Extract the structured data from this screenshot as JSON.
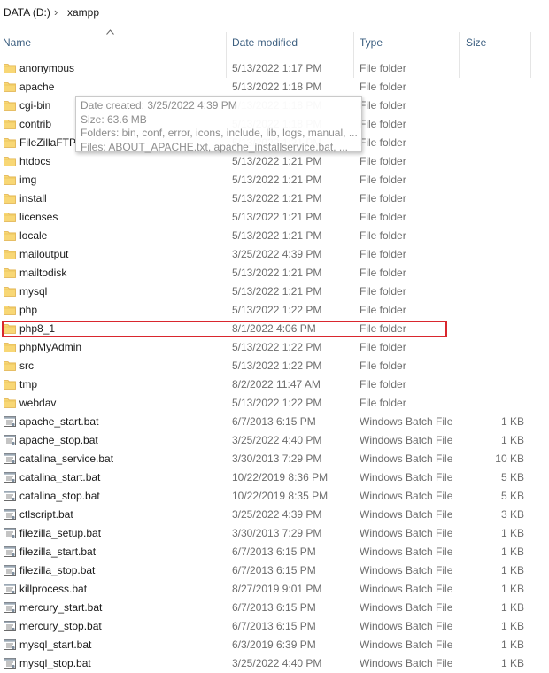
{
  "breadcrumb": {
    "drive": "DATA (D:)",
    "separator": "›",
    "folder": "xampp"
  },
  "columns": {
    "name": "Name",
    "date": "Date modified",
    "type": "Type",
    "size": "Size"
  },
  "tooltip": {
    "created": "Date created: 3/25/2022 4:39 PM",
    "size": "Size: 63.6 MB",
    "folders": "Folders: bin, conf, error, icons, include, lib, logs, manual, ...",
    "files": "Files: ABOUT_APACHE.txt, apache_installservice.bat, ..."
  },
  "files": [
    {
      "name": "anonymous",
      "date": "5/13/2022 1:17 PM",
      "type": "File folder",
      "size": "",
      "icon": "folder-icon"
    },
    {
      "name": "apache",
      "date": "5/13/2022 1:18 PM",
      "type": "File folder",
      "size": "",
      "icon": "folder-icon"
    },
    {
      "name": "cgi-bin",
      "date": "5/13/2022 1:18 PM",
      "type": "File folder",
      "size": "",
      "icon": "folder-icon"
    },
    {
      "name": "contrib",
      "date": "5/13/2022 1:18 PM",
      "type": "File folder",
      "size": "",
      "icon": "folder-icon"
    },
    {
      "name": "FileZillaFTP",
      "date": "5/13/2022 1:21 PM",
      "type": "File folder",
      "size": "",
      "icon": "folder-icon"
    },
    {
      "name": "htdocs",
      "date": "5/13/2022 1:21 PM",
      "type": "File folder",
      "size": "",
      "icon": "folder-icon"
    },
    {
      "name": "img",
      "date": "5/13/2022 1:21 PM",
      "type": "File folder",
      "size": "",
      "icon": "folder-icon"
    },
    {
      "name": "install",
      "date": "5/13/2022 1:21 PM",
      "type": "File folder",
      "size": "",
      "icon": "folder-icon"
    },
    {
      "name": "licenses",
      "date": "5/13/2022 1:21 PM",
      "type": "File folder",
      "size": "",
      "icon": "folder-icon"
    },
    {
      "name": "locale",
      "date": "5/13/2022 1:21 PM",
      "type": "File folder",
      "size": "",
      "icon": "folder-icon"
    },
    {
      "name": "mailoutput",
      "date": "3/25/2022 4:39 PM",
      "type": "File folder",
      "size": "",
      "icon": "folder-icon"
    },
    {
      "name": "mailtodisk",
      "date": "5/13/2022 1:21 PM",
      "type": "File folder",
      "size": "",
      "icon": "folder-icon"
    },
    {
      "name": "mysql",
      "date": "5/13/2022 1:21 PM",
      "type": "File folder",
      "size": "",
      "icon": "folder-icon"
    },
    {
      "name": "php",
      "date": "5/13/2022 1:22 PM",
      "type": "File folder",
      "size": "",
      "icon": "folder-icon"
    },
    {
      "name": "php8_1",
      "date": "8/1/2022 4:06 PM",
      "type": "File folder",
      "size": "",
      "icon": "folder-icon",
      "highlighted": true
    },
    {
      "name": "phpMyAdmin",
      "date": "5/13/2022 1:22 PM",
      "type": "File folder",
      "size": "",
      "icon": "folder-icon"
    },
    {
      "name": "src",
      "date": "5/13/2022 1:22 PM",
      "type": "File folder",
      "size": "",
      "icon": "folder-icon"
    },
    {
      "name": "tmp",
      "date": "8/2/2022 11:47 AM",
      "type": "File folder",
      "size": "",
      "icon": "folder-icon"
    },
    {
      "name": "webdav",
      "date": "5/13/2022 1:22 PM",
      "type": "File folder",
      "size": "",
      "icon": "folder-icon"
    },
    {
      "name": "apache_start.bat",
      "date": "6/7/2013 6:15 PM",
      "type": "Windows Batch File",
      "size": "1 KB",
      "icon": "batch-file-icon"
    },
    {
      "name": "apache_stop.bat",
      "date": "3/25/2022 4:40 PM",
      "type": "Windows Batch File",
      "size": "1 KB",
      "icon": "batch-file-icon"
    },
    {
      "name": "catalina_service.bat",
      "date": "3/30/2013 7:29 PM",
      "type": "Windows Batch File",
      "size": "10 KB",
      "icon": "batch-file-icon"
    },
    {
      "name": "catalina_start.bat",
      "date": "10/22/2019 8:36 PM",
      "type": "Windows Batch File",
      "size": "5 KB",
      "icon": "batch-file-icon"
    },
    {
      "name": "catalina_stop.bat",
      "date": "10/22/2019 8:35 PM",
      "type": "Windows Batch File",
      "size": "5 KB",
      "icon": "batch-file-icon"
    },
    {
      "name": "ctlscript.bat",
      "date": "3/25/2022 4:39 PM",
      "type": "Windows Batch File",
      "size": "3 KB",
      "icon": "batch-file-icon"
    },
    {
      "name": "filezilla_setup.bat",
      "date": "3/30/2013 7:29 PM",
      "type": "Windows Batch File",
      "size": "1 KB",
      "icon": "batch-file-icon"
    },
    {
      "name": "filezilla_start.bat",
      "date": "6/7/2013 6:15 PM",
      "type": "Windows Batch File",
      "size": "1 KB",
      "icon": "batch-file-icon"
    },
    {
      "name": "filezilla_stop.bat",
      "date": "6/7/2013 6:15 PM",
      "type": "Windows Batch File",
      "size": "1 KB",
      "icon": "batch-file-icon"
    },
    {
      "name": "killprocess.bat",
      "date": "8/27/2019 9:01 PM",
      "type": "Windows Batch File",
      "size": "1 KB",
      "icon": "batch-file-icon"
    },
    {
      "name": "mercury_start.bat",
      "date": "6/7/2013 6:15 PM",
      "type": "Windows Batch File",
      "size": "1 KB",
      "icon": "batch-file-icon"
    },
    {
      "name": "mercury_stop.bat",
      "date": "6/7/2013 6:15 PM",
      "type": "Windows Batch File",
      "size": "1 KB",
      "icon": "batch-file-icon"
    },
    {
      "name": "mysql_start.bat",
      "date": "6/3/2019 6:39 PM",
      "type": "Windows Batch File",
      "size": "1 KB",
      "icon": "batch-file-icon"
    },
    {
      "name": "mysql_stop.bat",
      "date": "3/25/2022 4:40 PM",
      "type": "Windows Batch File",
      "size": "1 KB",
      "icon": "batch-file-icon"
    }
  ],
  "colors": {
    "highlight_border": "#d9272e",
    "folder": "#f8d775",
    "header_text": "#3c5f80"
  }
}
